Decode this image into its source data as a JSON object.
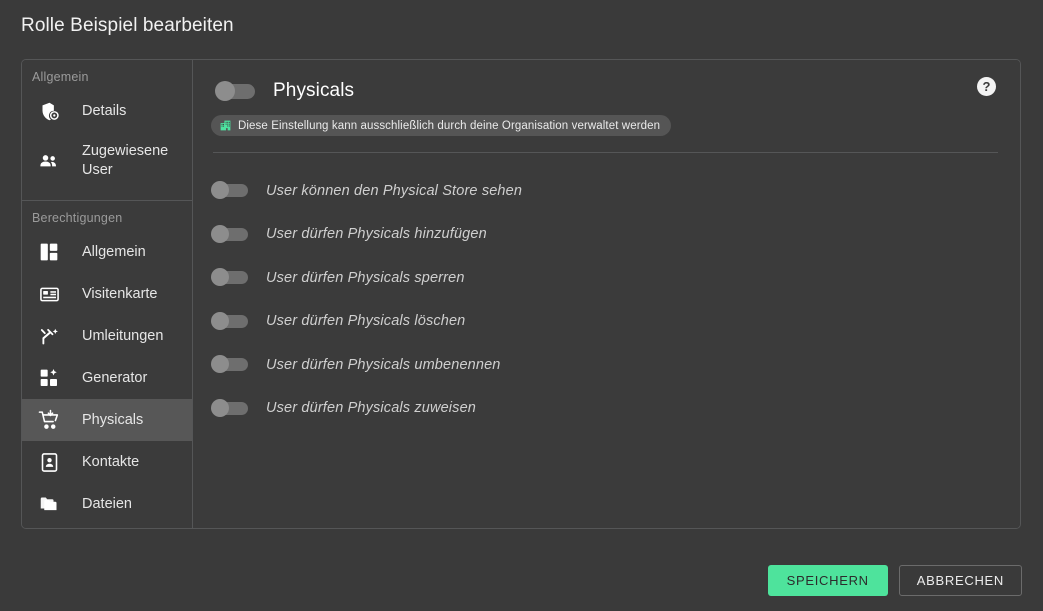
{
  "page": {
    "title": "Rolle Beispiel bearbeiten"
  },
  "sidebar": {
    "groups": [
      {
        "label": "Allgemein",
        "items": [
          {
            "label": "Details",
            "icon": "shield-gear-icon",
            "active": false
          },
          {
            "label": "Zugewiesene User",
            "icon": "users-icon",
            "active": false
          }
        ]
      },
      {
        "label": "Berechtigungen",
        "items": [
          {
            "label": "Allgemein",
            "icon": "dashboard-icon",
            "active": false
          },
          {
            "label": "Visitenkarte",
            "icon": "card-icon",
            "active": false
          },
          {
            "label": "Umleitungen",
            "icon": "redirect-icon",
            "active": false
          },
          {
            "label": "Generator",
            "icon": "generator-icon",
            "active": false
          },
          {
            "label": "Physicals",
            "icon": "cart-icon",
            "active": true
          },
          {
            "label": "Kontakte",
            "icon": "contact-icon",
            "active": false
          },
          {
            "label": "Dateien",
            "icon": "folder-icon",
            "active": false
          }
        ]
      }
    ]
  },
  "main": {
    "title": "Physicals",
    "master_toggle": {
      "name": "physicals-master-toggle",
      "state": "off"
    },
    "help_icon_label": "?",
    "org_banner": {
      "icon": "organization-building-icon",
      "text": "Diese Einstellung kann ausschließlich durch deine Organisation verwaltet werden",
      "icon_color": "#4ee3a0"
    },
    "permissions": [
      {
        "label": "User können den Physical Store sehen",
        "state": "off"
      },
      {
        "label": "User dürfen Physicals hinzufügen",
        "state": "off"
      },
      {
        "label": "User dürfen Physicals sperren",
        "state": "off"
      },
      {
        "label": "User dürfen Physicals löschen",
        "state": "off"
      },
      {
        "label": "User dürfen Physicals umbenennen",
        "state": "off"
      },
      {
        "label": "User dürfen Physicals zuweisen",
        "state": "off"
      }
    ]
  },
  "footer": {
    "save_label": "SPEICHERN",
    "cancel_label": "ABBRECHEN",
    "save_color": "#4ee39c"
  }
}
